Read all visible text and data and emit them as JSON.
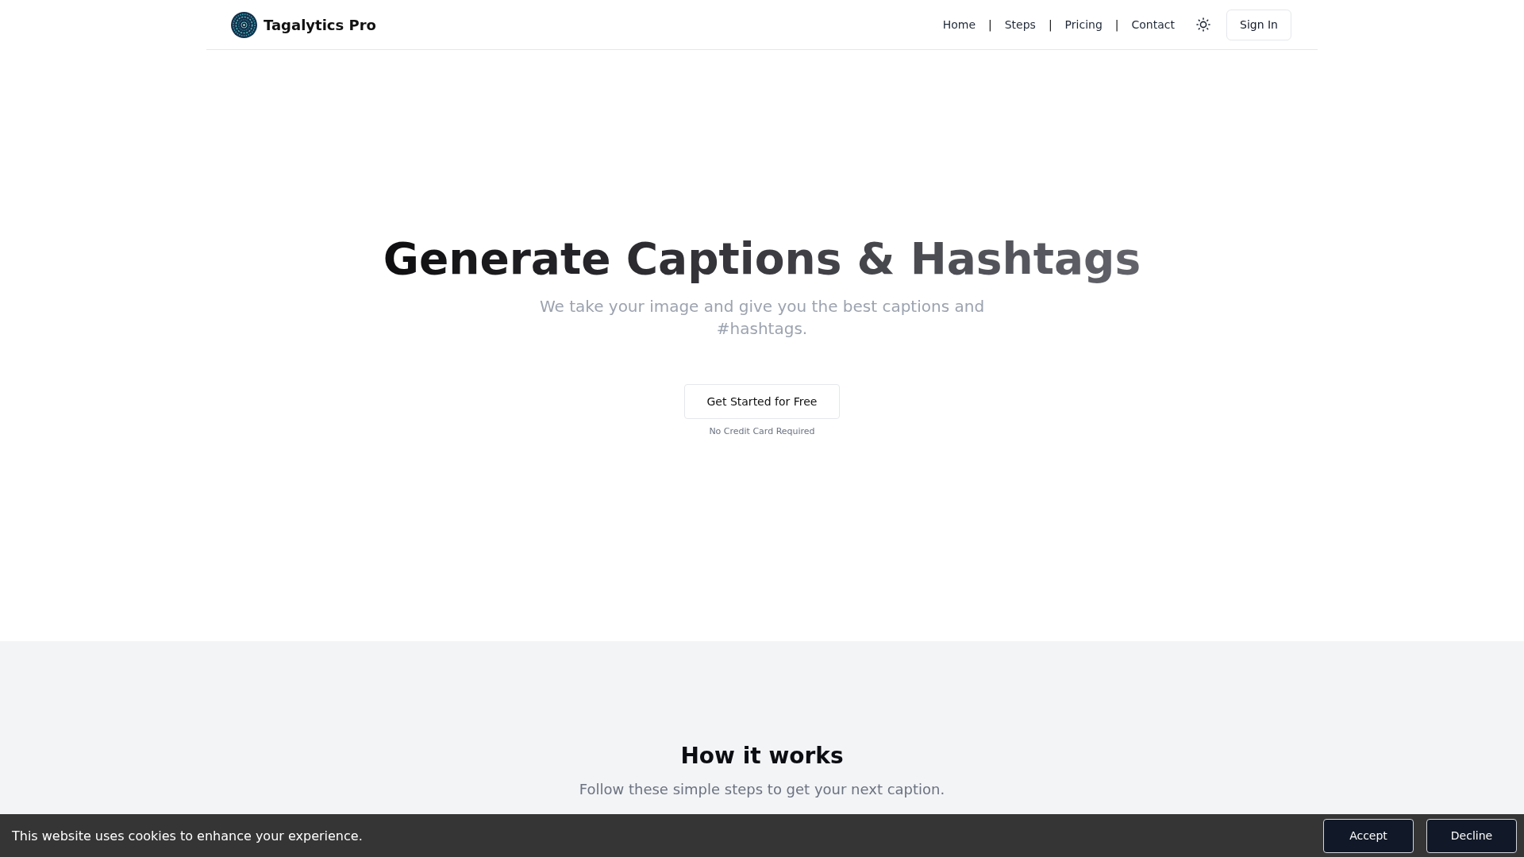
{
  "header": {
    "brand": "Tagalytics Pro",
    "nav": [
      {
        "kind": "link",
        "label": "Home"
      },
      {
        "kind": "separator",
        "label": "|"
      },
      {
        "kind": "link",
        "label": "Steps"
      },
      {
        "kind": "separator",
        "label": "|"
      },
      {
        "kind": "link",
        "label": "Pricing"
      },
      {
        "kind": "separator",
        "label": "|"
      },
      {
        "kind": "link",
        "label": "Contact"
      }
    ],
    "sign_in": "Sign In"
  },
  "hero": {
    "title": "Generate Captions & Hashtags",
    "subtitle": "We take your image and give you the best captions and #hashtags.",
    "cta": "Get Started for Free",
    "note": "No Credit Card Required"
  },
  "how_it_works": {
    "title": "How it works",
    "subtitle": "Follow these simple steps to get your next caption."
  },
  "cookie_banner": {
    "message": "This website uses cookies to enhance your experience.",
    "buttons": [
      {
        "label": "Accept"
      },
      {
        "label": "Decline"
      }
    ]
  }
}
